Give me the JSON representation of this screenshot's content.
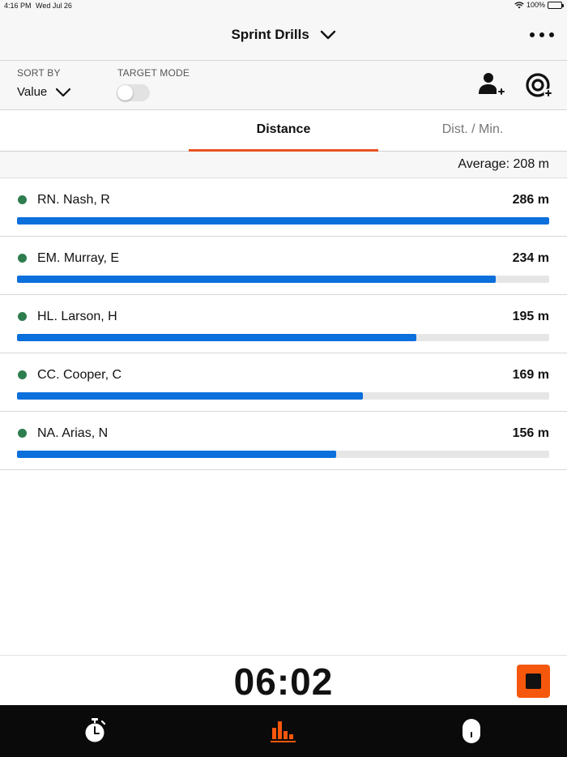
{
  "status_bar": {
    "time": "4:16 PM",
    "date": "Wed Jul 26",
    "battery": "100%"
  },
  "header": {
    "title": "Sprint Drills"
  },
  "controls": {
    "sort_label": "SORT BY",
    "sort_value": "Value",
    "target_label": "TARGET MODE",
    "target_mode_on": false
  },
  "tabs": [
    {
      "label": "Distance",
      "active": true
    },
    {
      "label": "Dist. / Min.",
      "active": false
    }
  ],
  "average": "Average: 208 m",
  "athletes": [
    {
      "name": "RN. Nash, R",
      "value": "286 m",
      "fraction": 1.0
    },
    {
      "name": "EM. Murray, E",
      "value": "234 m",
      "fraction": 0.9
    },
    {
      "name": "HL. Larson, H",
      "value": "195 m",
      "fraction": 0.75
    },
    {
      "name": "CC. Cooper, C",
      "value": "169 m",
      "fraction": 0.65
    },
    {
      "name": "NA. Arias, N",
      "value": "156 m",
      "fraction": 0.6
    }
  ],
  "timer": "06:02",
  "colors": {
    "accent": "#e8531f",
    "stop": "#f5570c",
    "bar": "#0b6fdc",
    "status_dot": "#2e7d4f"
  },
  "bottom_nav": [
    {
      "icon": "stopwatch-icon",
      "active": false
    },
    {
      "icon": "bar-chart-icon",
      "active": true
    },
    {
      "icon": "device-icon",
      "active": false
    }
  ]
}
